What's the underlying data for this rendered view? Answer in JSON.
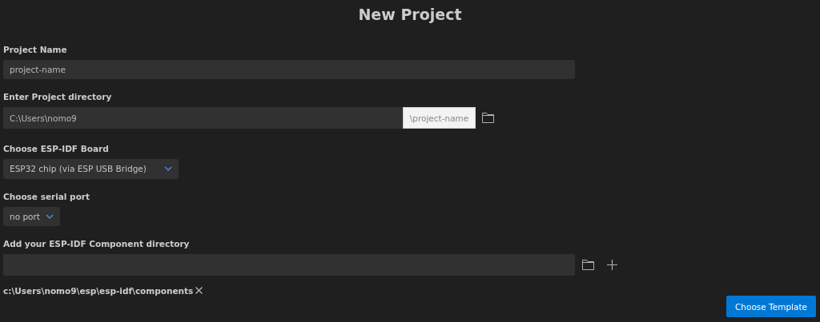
{
  "title": "New Project",
  "project_name": {
    "label": "Project Name",
    "value": "project-name"
  },
  "project_directory": {
    "label": "Enter Project directory",
    "value": "C:\\Users\\nomo9",
    "suffix": "\\project-name"
  },
  "board": {
    "label": "Choose ESP-IDF Board",
    "value": "ESP32 chip (via ESP USB Bridge)"
  },
  "serial_port": {
    "label": "Choose serial port",
    "value": "no port"
  },
  "component_directory": {
    "label": "Add your ESP-IDF Component directory",
    "entries": [
      "c:\\Users\\nomo9\\esp\\esp-idf\\components"
    ]
  },
  "button": "Choose Template"
}
